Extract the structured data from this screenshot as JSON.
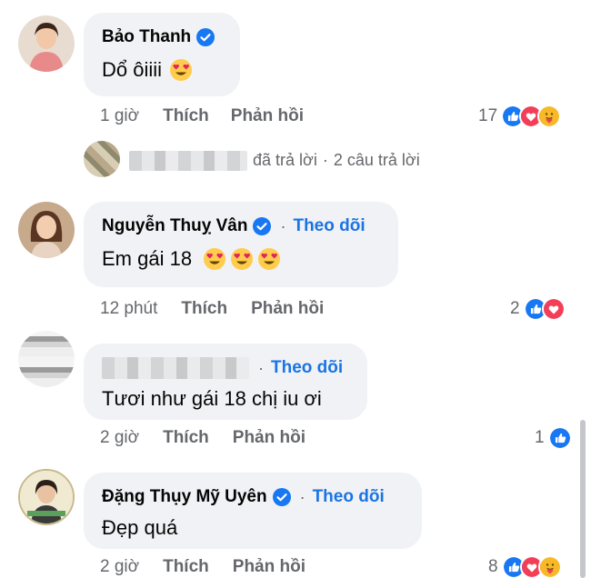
{
  "comments": [
    {
      "name": "Bảo Thanh",
      "text": "Dổ ôiiii",
      "time": "1 giờ",
      "like": "Thích",
      "reply": "Phản hồi",
      "reaction_count": "17",
      "reactions": [
        "like",
        "love",
        "care"
      ]
    },
    {
      "name": "Nguyễn Thuỵ Vân",
      "follow": "Theo dõi",
      "text": "Em gái 18",
      "time": "12 phút",
      "like": "Thích",
      "reply": "Phản hồi",
      "reaction_count": "2",
      "reactions": [
        "like",
        "love"
      ]
    },
    {
      "follow": "Theo dõi",
      "text": "Tươi như gái 18 chị iu ơi",
      "time": "2 giờ",
      "like": "Thích",
      "reply": "Phản hồi",
      "reaction_count": "1",
      "reactions": [
        "like"
      ]
    },
    {
      "name": "Đặng Thụy Mỹ Uyên",
      "follow": "Theo dõi",
      "text": "Đẹp quá",
      "time": "2 giờ",
      "like": "Thích",
      "reply": "Phản hồi",
      "reaction_count": "8",
      "reactions": [
        "like",
        "love",
        "care"
      ]
    }
  ],
  "replies_line": {
    "replied": "đã trả lời",
    "separator": "·",
    "count": "2 câu trả lời"
  },
  "separator": "·",
  "colors": {
    "bubble": "#f0f2f5",
    "link": "#1b74e4",
    "meta": "#65676b",
    "like": "#1877f2",
    "love": "#f33e58",
    "care": "#f7b928"
  }
}
